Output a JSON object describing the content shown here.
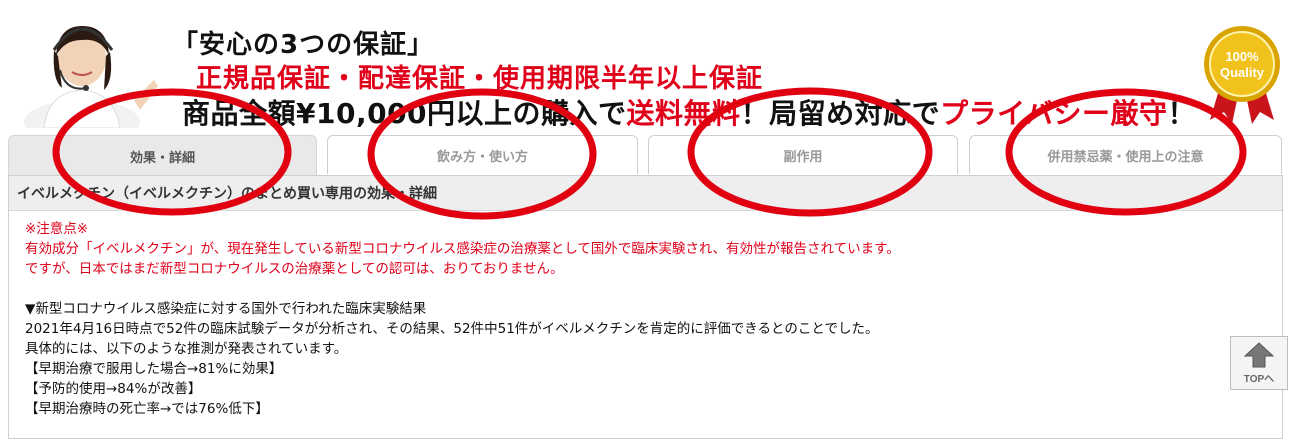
{
  "banner": {
    "title": "「安心の3つの保証」",
    "guarantees": "正規品保証・配達保証・使用期限半年以上保証",
    "line3_part1": "商品全額¥10,000円以上の購入で",
    "line3_part2": "送料無料",
    "line3_part3": "！局留め対応で",
    "line3_part4": "プライバシー厳守",
    "line3_part5": "！",
    "seal_top": "100%",
    "seal_bottom": "Quality"
  },
  "tabs": [
    {
      "label": "効果・詳細",
      "active": true
    },
    {
      "label": "飲み方・使い方",
      "active": false
    },
    {
      "label": "副作用",
      "active": false
    },
    {
      "label": "併用禁忌薬・使用上の注意",
      "active": false
    }
  ],
  "panel": {
    "heading": "イベルメクチン（イベルメクチン）のまとめ買い専用の効果・詳細",
    "notice_title": "※注意点※",
    "notice_1": "有効成分「イベルメクチン」が、現在発生している新型コロナウイルス感染症の治療薬として国外で臨床実験され、有効性が報告されています。",
    "notice_2": "ですが、日本ではまだ新型コロナウイルスの治療薬としての認可は、おりておりません。",
    "section_title": "▼新型コロナウイルス感染症に対する国外で行われた臨床実験結果",
    "line_1": "2021年4月16日時点で52件の臨床試験データが分析され、その結果、52件中51件がイベルメクチンを肯定的に評価できるとのことでした。",
    "line_2": "具体的には、以下のような推測が発表されています。",
    "result_1": "【早期治療で服用した場合→81%に効果】",
    "result_2": "【予防的使用→84%が改善】",
    "result_3": "【早期治療時の死亡率→では76%低下】"
  },
  "top_button": {
    "label": "TOPへ"
  },
  "colors": {
    "accent_red": "#e0001a",
    "tab_active_bg": "#e9e9e9",
    "panel_head_bg": "#eeeeee"
  }
}
